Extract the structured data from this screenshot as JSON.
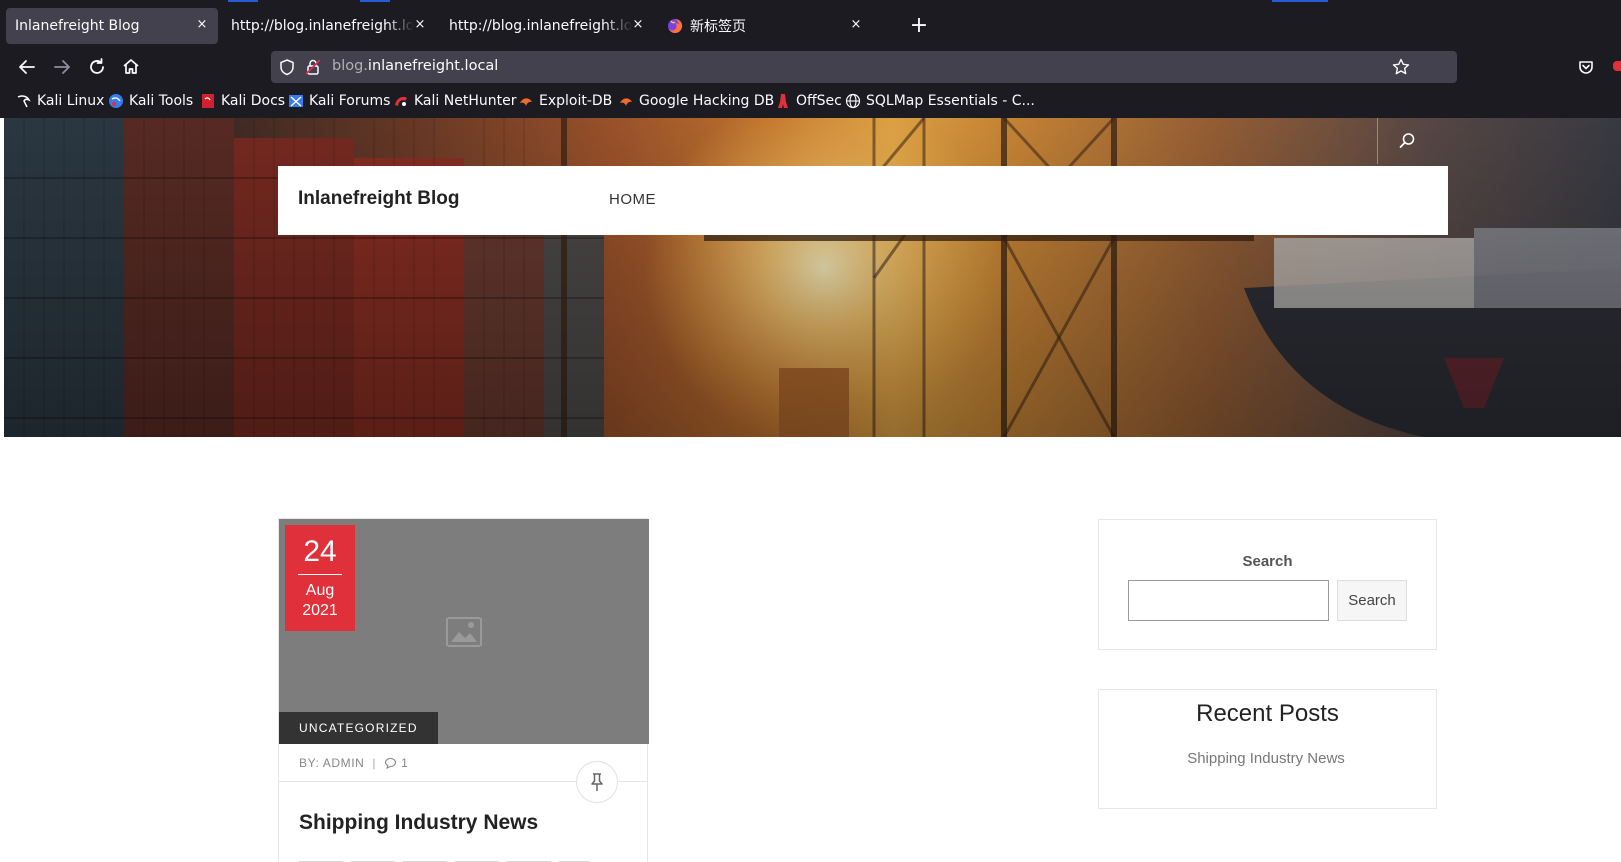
{
  "browser": {
    "tabs": [
      {
        "title": "Inlanefreight Blog",
        "active": true
      },
      {
        "title": "http://blog.inlanefreight.local/",
        "active": false
      },
      {
        "title": "http://blog.inlanefreight.local/",
        "active": false
      },
      {
        "title": "新标签页",
        "active": false,
        "icon": "firefox-icon"
      }
    ],
    "tab_close_glyph": "×",
    "new_tab_glyph": "+",
    "url": {
      "subdomain": "blog.",
      "domain": "inlanefreight.local"
    },
    "bookmarks": [
      {
        "label": "Kali Linux",
        "icon": "kali-dragon-icon"
      },
      {
        "label": "Kali Tools",
        "icon": "kali-tools-icon"
      },
      {
        "label": "Kali Docs",
        "icon": "kali-docs-icon"
      },
      {
        "label": "Kali Forums",
        "icon": "kali-forums-icon"
      },
      {
        "label": "Kali NetHunter",
        "icon": "nethunter-icon"
      },
      {
        "label": "Exploit-DB",
        "icon": "exploit-db-icon"
      },
      {
        "label": "Google Hacking DB",
        "icon": "ghdb-icon"
      },
      {
        "label": "OffSec",
        "icon": "offsec-icon"
      },
      {
        "label": "SQLMap Essentials - C...",
        "icon": "globe-icon"
      }
    ],
    "colors": {
      "chrome_bg": "#1c1b22",
      "field_bg": "#42414d",
      "text": "#fbfbfe"
    }
  },
  "site": {
    "title": "Inlanefreight Blog",
    "menu": [
      {
        "label": "HOME"
      }
    ],
    "colors": {
      "accent": "#e0303a",
      "dark": "#333333"
    }
  },
  "post": {
    "date": {
      "day": "24",
      "month": "Aug",
      "year": "2021"
    },
    "category": "UNCATEGORIZED",
    "author": "BY: ADMIN",
    "meta_sep": "|",
    "comments": "1",
    "title": "Shipping Industry News"
  },
  "sidebar": {
    "search": {
      "heading": "Search",
      "button": "Search",
      "value": ""
    },
    "recent": {
      "heading": "Recent Posts",
      "items": [
        "Shipping Industry News"
      ]
    }
  }
}
